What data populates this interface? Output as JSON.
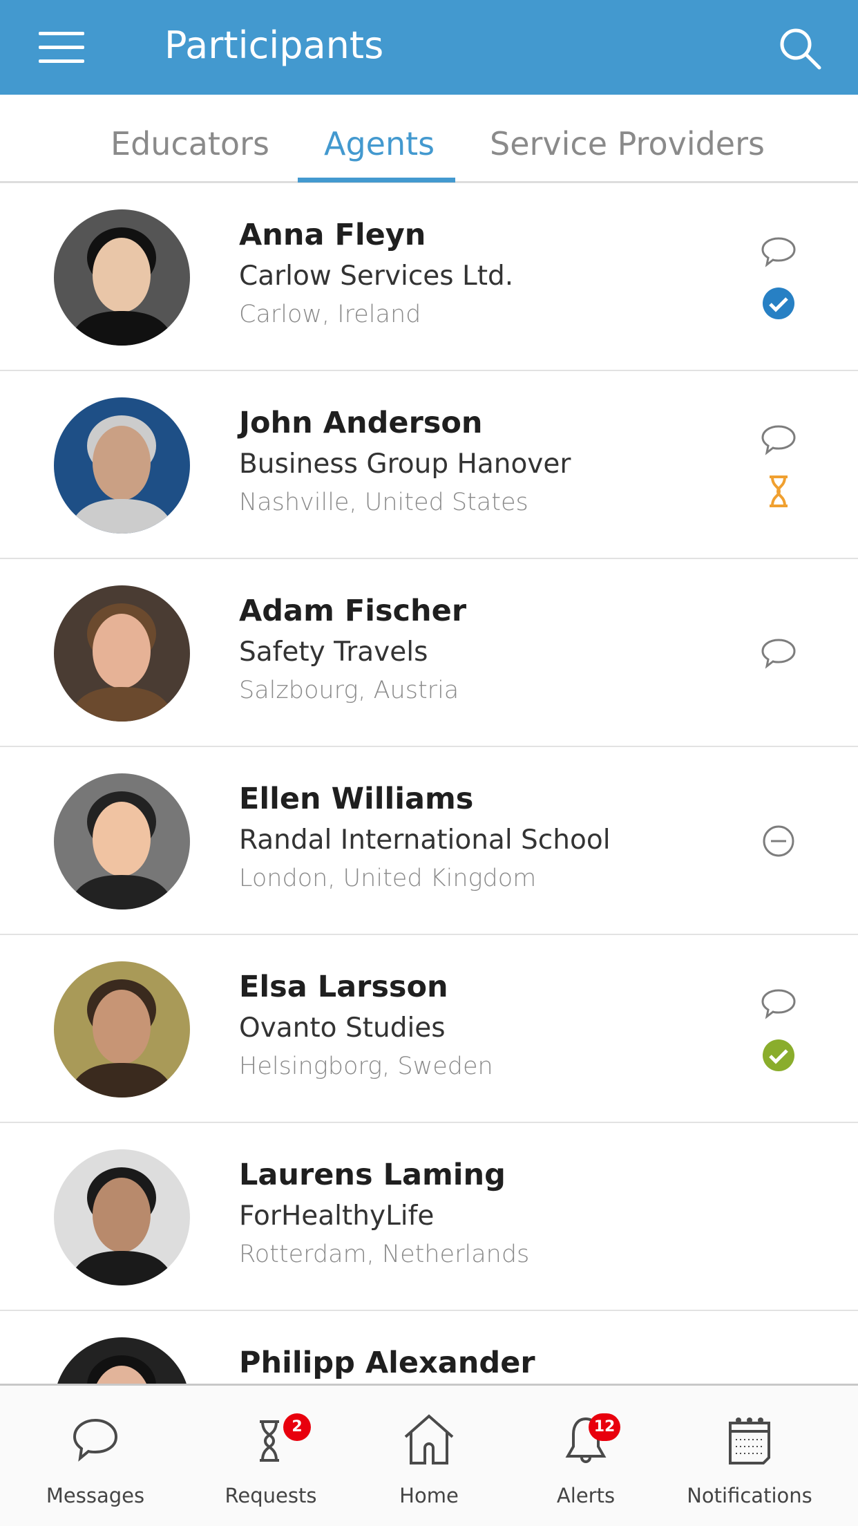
{
  "header": {
    "title": "Participants",
    "menu_icon": "hamburger-icon",
    "search_icon": "search-icon",
    "color": "#4399cf"
  },
  "tabs": [
    {
      "label": "Educators"
    },
    {
      "label": "Agents",
      "active": true
    },
    {
      "label": "Service Providers"
    }
  ],
  "participants": [
    {
      "name": "Anna Fleyn",
      "company": "Carlow Services Ltd.",
      "location": "Carlow, Ireland",
      "icons": [
        "chat-icon",
        "verified-blue-check-icon"
      ]
    },
    {
      "name": "John Anderson",
      "company": "Business Group Hanover",
      "location": "Nashville, United States",
      "icons": [
        "chat-icon",
        "pending-hourglass-icon"
      ]
    },
    {
      "name": "Adam Fischer",
      "company": "Safety Travels",
      "location": "Salzbourg, Austria",
      "icons": [
        "chat-icon"
      ]
    },
    {
      "name": "Ellen Williams",
      "company": "Randal International School",
      "location": "London, United Kingdom",
      "icons": [
        "minus-circle-icon"
      ]
    },
    {
      "name": "Elsa Larsson",
      "company": "Ovanto Studies",
      "location": "Helsingborg, Sweden",
      "icons": [
        "chat-icon",
        "verified-green-check-icon"
      ]
    },
    {
      "name": "Laurens Laming",
      "company": "ForHealthyLife",
      "location": "Rotterdam, Netherlands",
      "icons": []
    },
    {
      "name": "Philipp Alexander",
      "company": "",
      "location": "",
      "icons": []
    }
  ],
  "bottom_nav": [
    {
      "label": "Messages",
      "icon": "chat-icon"
    },
    {
      "label": "Requests",
      "icon": "hourglass-icon",
      "badge": "2"
    },
    {
      "label": "Home",
      "icon": "home-icon"
    },
    {
      "label": "Alerts",
      "icon": "bell-icon",
      "badge": "12"
    },
    {
      "label": "Notifications",
      "icon": "calendar-icon"
    }
  ]
}
